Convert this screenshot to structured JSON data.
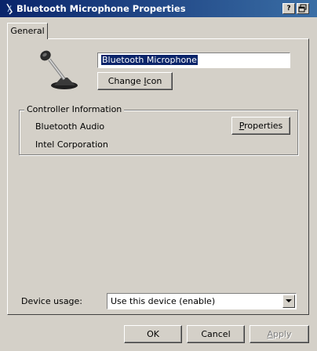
{
  "window": {
    "title": "Bluetooth Microphone Properties",
    "help_glyph": "?",
    "icon": "bluetooth-icon"
  },
  "tabs": [
    {
      "label": "General",
      "selected": true
    }
  ],
  "general": {
    "device_icon": "microphone-icon",
    "device_name": "Bluetooth Microphone",
    "change_icon_button": {
      "pre": "Change ",
      "accel": "I",
      "post": "con"
    },
    "controller_group_label": "Controller Information",
    "controller_name": "Bluetooth Audio",
    "controller_vendor": "Intel Corporation",
    "properties_button": {
      "pre": "",
      "accel": "P",
      "post": "roperties"
    },
    "device_usage_label": "Device usage:",
    "device_usage_value": "Use this device (enable)"
  },
  "buttons": {
    "ok": "OK",
    "cancel": "Cancel",
    "apply": {
      "pre": "",
      "accel": "A",
      "post": "pply",
      "enabled": false
    }
  },
  "colors": {
    "titlebar_start": "#0a246a",
    "titlebar_end": "#3a6ea5",
    "dialog_face": "#d4d0c8",
    "selection": "#0a246a"
  }
}
